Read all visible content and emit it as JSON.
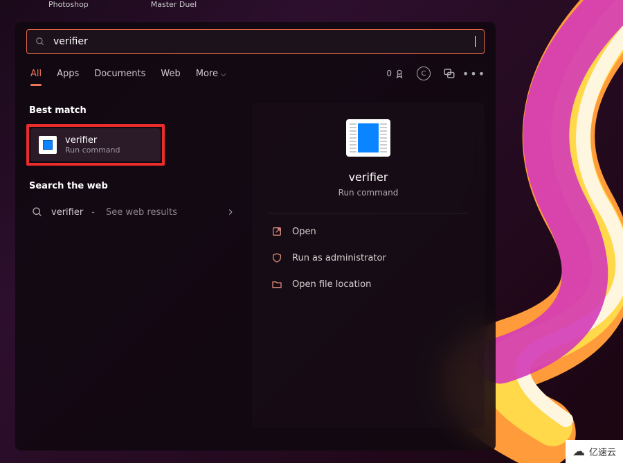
{
  "desktop": {
    "icons": [
      "Photoshop",
      "Master Duel"
    ]
  },
  "search": {
    "value": "verifier"
  },
  "tabs": [
    "All",
    "Apps",
    "Documents",
    "Web",
    "More"
  ],
  "points": "0",
  "section": {
    "best_match": "Best match",
    "search_web": "Search the web"
  },
  "best": {
    "title": "verifier",
    "subtitle": "Run command"
  },
  "web": {
    "term": "verifier",
    "hint": "See web results"
  },
  "detail": {
    "title": "verifier",
    "subtitle": "Run command"
  },
  "actions": [
    "Open",
    "Run as administrator",
    "Open file location"
  ],
  "watermark": "亿速云"
}
